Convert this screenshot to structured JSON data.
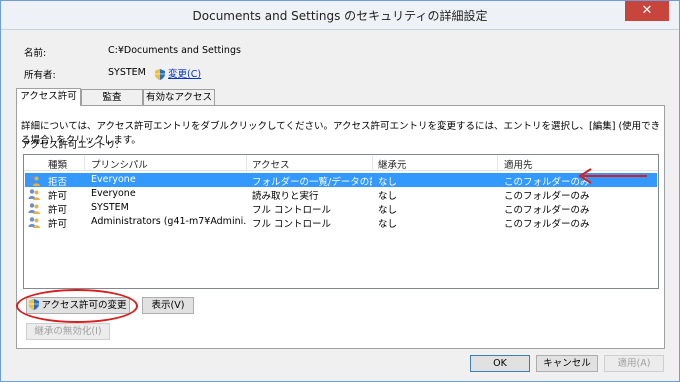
{
  "window": {
    "title": "Documents and Settings のセキュリティの詳細設定",
    "close_glyph": "✕"
  },
  "info": {
    "name_label": "名前:",
    "name_value": "C:¥Documents and Settings",
    "owner_label": "所有者:",
    "owner_value": "SYSTEM",
    "owner_change_link": "変更(C)"
  },
  "tabs": [
    {
      "label": "アクセス許可"
    },
    {
      "label": "監査"
    },
    {
      "label": "有効なアクセス"
    }
  ],
  "panel": {
    "description": "詳細については、アクセス許可エントリをダブルクリックしてください。アクセス許可エントリを変更するには、エントリを選択し、[編集] (使用できる場合) をクリックします。",
    "entries_label": "アクセス許可エントリ:"
  },
  "table": {
    "columns": [
      "種類",
      "プリンシパル",
      "アクセス",
      "継承元",
      "適用先"
    ],
    "rows": [
      {
        "type": "拒否",
        "principal": "Everyone",
        "access": "フォルダーの一覧/データの読み...",
        "inherited_from": "なし",
        "applies_to": "このフォルダーのみ",
        "selected": true
      },
      {
        "type": "許可",
        "principal": "Everyone",
        "access": "読み取りと実行",
        "inherited_from": "なし",
        "applies_to": "このフォルダーのみ",
        "selected": false
      },
      {
        "type": "許可",
        "principal": "SYSTEM",
        "access": "フル コントロール",
        "inherited_from": "なし",
        "applies_to": "このフォルダーのみ",
        "selected": false
      },
      {
        "type": "許可",
        "principal": "Administrators (g41-m7¥Admini...",
        "access": "フル コントロール",
        "inherited_from": "なし",
        "applies_to": "このフォルダーのみ",
        "selected": false
      }
    ]
  },
  "buttons": {
    "change_permissions": "アクセス許可の変更",
    "view": "表示(V)",
    "disable_inheritance": "継承の無効化(I)",
    "ok": "OK",
    "cancel": "キャンセル",
    "apply": "適用(A)"
  },
  "colors": {
    "selection": "#3399ff",
    "annotation": "#d81e1e",
    "link": "#0033cc"
  }
}
